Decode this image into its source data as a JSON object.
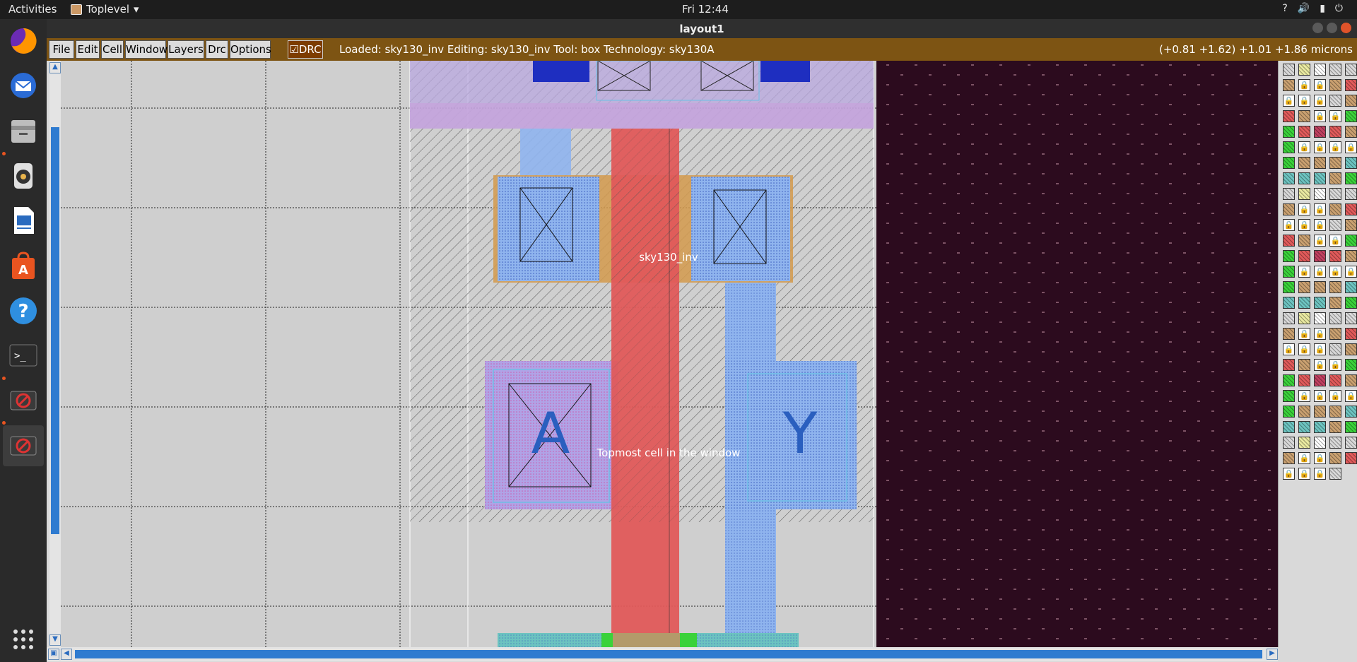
{
  "topbar": {
    "activities": "Activities",
    "app_name": "Toplevel",
    "clock": "Fri 12:44",
    "tray_icons": [
      "help-icon",
      "volume-icon",
      "battery-icon",
      "power-icon"
    ]
  },
  "dock": {
    "items": [
      {
        "name": "firefox-icon",
        "color": "#e66000"
      },
      {
        "name": "thunderbird-icon",
        "color": "#3a7bd5"
      },
      {
        "name": "files-icon",
        "color": "#9a9a9a"
      },
      {
        "name": "rhythmbox-icon",
        "color": "#e9b44c"
      },
      {
        "name": "writer-icon",
        "color": "#2a6bbf"
      },
      {
        "name": "software-icon",
        "color": "#e95420"
      },
      {
        "name": "help-icon",
        "color": "#2f8fe0"
      },
      {
        "name": "terminal-icon",
        "color": "#333333"
      },
      {
        "name": "magic-icon",
        "color": "#c0392b"
      },
      {
        "name": "magic-icon",
        "color": "#c0392b"
      }
    ],
    "show_apps_icon": "grid-icon"
  },
  "window": {
    "title": "layout1"
  },
  "menu": {
    "items": [
      "File",
      "Edit",
      "Cell",
      "Window",
      "Layers",
      "Drc",
      "Options"
    ],
    "drc_toggle": "DRC",
    "drc_checked": true,
    "status": "Loaded: sky130_inv Editing: sky130_inv Tool: box  Technology: sky130A",
    "coords": "(+0.81 +1.62) +1.01 +1.86 microns"
  },
  "layout": {
    "cell_label": "sky130_inv",
    "topmost_label": "Topmost cell in the window",
    "port_a": "A",
    "port_y": "Y",
    "colors": {
      "background": "#cfcfcf",
      "dark_region": "#2c0b1e",
      "poly": "#e05a5a",
      "metal1": "#a9b8f0",
      "local_interconnect": "#8fb4ee",
      "diffusion_border": "#d49a4c",
      "nwell": "#b9a8e0"
    }
  }
}
